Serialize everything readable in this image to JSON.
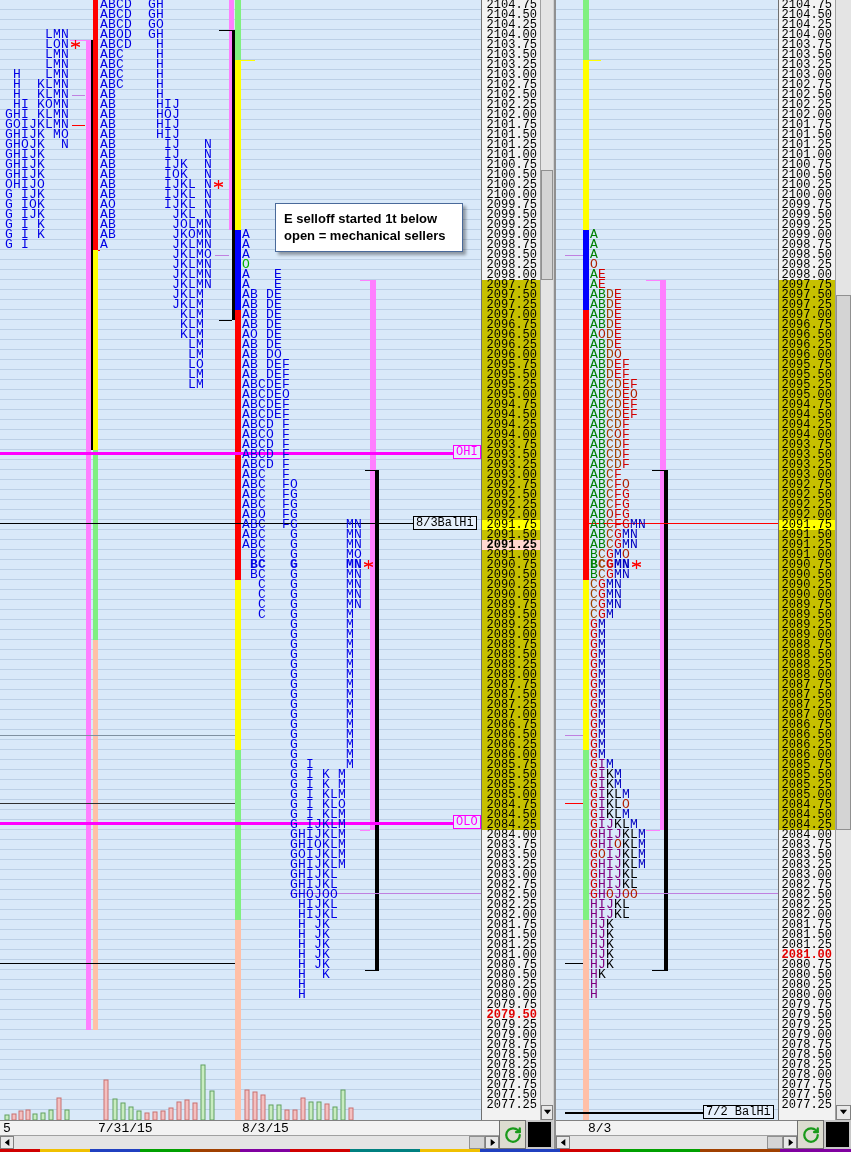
{
  "left_pane": {
    "rows": [
      {
        "price": "2104.75",
        "kind": "plain",
        "p2": "ABCD  GH"
      },
      {
        "price": "2104.50",
        "kind": "plain",
        "p2": "ABCD  GH"
      },
      {
        "price": "2104.25",
        "kind": "plain",
        "p2": "ABCD  GO"
      },
      {
        "price": "2104.00",
        "kind": "plain",
        "p1": "     LMN",
        "p2": "ABOD  GH"
      },
      {
        "price": "2103.75",
        "kind": "plain",
        "p1": "     LON",
        "p1_star": true,
        "p2": "ABCD   H"
      },
      {
        "price": "2103.50",
        "kind": "plain",
        "p1": "     LMN",
        "p2": "ABC    H"
      },
      {
        "price": "2103.25",
        "kind": "plain",
        "p1": "     LMN",
        "p2": "ABC    H"
      },
      {
        "price": "2103.00",
        "kind": "plain",
        "p1": " H   LMN",
        "p2": "ABC    H"
      },
      {
        "price": "2102.75",
        "kind": "plain",
        "p1": " H  KLMN",
        "p2": "ABC    H"
      },
      {
        "price": "2102.50",
        "kind": "plain",
        "p1": " H  KLMN",
        "p2": "AB     H"
      },
      {
        "price": "2102.25",
        "kind": "plain",
        "p1": " HI KOMN",
        "p2": "AB     HIJ"
      },
      {
        "price": "2102.00",
        "kind": "plain",
        "p1": "GHI KLMN",
        "p2": "AB     HOJ"
      },
      {
        "price": "2101.75",
        "kind": "plain",
        "p1": "GOIJKLMN",
        "p2": "AB     HIJ"
      },
      {
        "price": "2101.50",
        "kind": "plain",
        "p1": "GHIJK MO",
        "p2": "AB     HIJ"
      },
      {
        "price": "2101.25",
        "kind": "plain",
        "p1": "GHOJK  N",
        "p2": "AB      IJ   N"
      },
      {
        "price": "2101.00",
        "kind": "plain",
        "p1": "GHIJK",
        "p2": "AB      IJ   N"
      },
      {
        "price": "2100.75",
        "kind": "plain",
        "p1": "GHIJK",
        "p2": "AB      IJK  N"
      },
      {
        "price": "2100.50",
        "kind": "plain",
        "p1": "GHIJK",
        "p2": "AB      IOK  N"
      },
      {
        "price": "2100.25",
        "kind": "plain",
        "p1": "OHIJO",
        "p2": "AB      IJKL N",
        "p2_star": true
      },
      {
        "price": "2100.00",
        "kind": "plain",
        "p1": "G IJK",
        "p2": "AB      IJKL N"
      },
      {
        "price": "2099.75",
        "kind": "plain",
        "p1": "G IOK",
        "p2": "AO      IJKL N"
      },
      {
        "price": "2099.50",
        "kind": "plain",
        "p1": "G IJK",
        "p2": "AB       JKL N"
      },
      {
        "price": "2099.25",
        "kind": "plain",
        "p1": "G I K",
        "p2": "AB       JOLMN"
      },
      {
        "price": "2099.00",
        "kind": "plain",
        "p1": "G I K",
        "p2": "AB       JKOMN",
        "p3": "A"
      },
      {
        "price": "2098.75",
        "kind": "plain",
        "p1": "G I",
        "p2": "A        JKLMN",
        "p3": "A"
      },
      {
        "price": "2098.50",
        "kind": "plain",
        "p2": "         JKLMO",
        "p3": "A"
      },
      {
        "price": "2098.25",
        "kind": "plain",
        "p2": "         JKLMN",
        "p3": "O",
        "p3_open": true
      },
      {
        "price": "2098.00",
        "kind": "plain",
        "p2": "         JKLMN",
        "p3": "A   E"
      },
      {
        "price": "2097.75",
        "kind": "value_area",
        "p2": "         JKLMN",
        "p3": "A   E"
      },
      {
        "price": "2097.50",
        "kind": "value_area",
        "p2": "         JKLM",
        "p3": "AB DE"
      },
      {
        "price": "2097.25",
        "kind": "value_area",
        "p2": "         JKLM",
        "p3": "AB DE"
      },
      {
        "price": "2097.00",
        "kind": "value_area",
        "p2": "          KLM",
        "p3": "AB DE"
      },
      {
        "price": "2096.75",
        "kind": "value_area",
        "p2": "          KLM",
        "p3": "AB DE"
      },
      {
        "price": "2096.50",
        "kind": "value_area",
        "p2": "          KLM",
        "p3": "AO DE"
      },
      {
        "price": "2096.25",
        "kind": "value_area",
        "p2": "           LM",
        "p3": "AB DE"
      },
      {
        "price": "2096.00",
        "kind": "value_area",
        "p2": "           LM",
        "p3": "AB DO"
      },
      {
        "price": "2095.75",
        "kind": "value_area",
        "p2": "           LO",
        "p3": "AB DEF"
      },
      {
        "price": "2095.50",
        "kind": "value_area",
        "p2": "           LM",
        "p3": "AB DEF"
      },
      {
        "price": "2095.25",
        "kind": "value_area",
        "p2": "           LM",
        "p3": "ABCDEF"
      },
      {
        "price": "2095.00",
        "kind": "value_area",
        "p3": "ABCDEO"
      },
      {
        "price": "2094.75",
        "kind": "value_area",
        "p3": "ABCDEF"
      },
      {
        "price": "2094.50",
        "kind": "value_area",
        "p3": "ABCDEF"
      },
      {
        "price": "2094.25",
        "kind": "value_area",
        "p3": "ABCD F"
      },
      {
        "price": "2094.00",
        "kind": "value_area",
        "p3": "ABCO F"
      },
      {
        "price": "2093.75",
        "kind": "value_area",
        "p3": "ABCD F"
      },
      {
        "price": "2093.50",
        "kind": "value_area",
        "p3": "ABCD F"
      },
      {
        "price": "2093.25",
        "kind": "value_area",
        "p3": "ABCD F"
      },
      {
        "price": "2093.00",
        "kind": "value_area",
        "p3": "ABC  F"
      },
      {
        "price": "2092.75",
        "kind": "value_area",
        "p3": "ABC  FO"
      },
      {
        "price": "2092.50",
        "kind": "value_area",
        "p3": "ABC  FG"
      },
      {
        "price": "2092.25",
        "kind": "value_area",
        "p3": "ABC  FG"
      },
      {
        "price": "2092.00",
        "kind": "value_area",
        "p3": "ABO  FG"
      },
      {
        "price": "2091.75",
        "kind": "current",
        "p3": "ABC  FG      MN"
      },
      {
        "price": "2091.50",
        "kind": "value_area",
        "p3": "ABC   G      MN"
      },
      {
        "price": "2091.25",
        "kind": "poc",
        "p3": "ABC   G      MN"
      },
      {
        "price": "2091.00",
        "kind": "value_area",
        "p3": " BC   G      MO"
      },
      {
        "price": "2090.75",
        "kind": "value_area",
        "p3": " BC   G      MN",
        "p3_star": true,
        "bold": true
      },
      {
        "price": "2090.50",
        "kind": "value_area",
        "p3": " BC   G      MN"
      },
      {
        "price": "2090.25",
        "kind": "value_area",
        "p3": "  C   G      MN"
      },
      {
        "price": "2090.00",
        "kind": "value_area",
        "p3": "  C   G      MN"
      },
      {
        "price": "2089.75",
        "kind": "value_area",
        "p3": "  C   G      MN"
      },
      {
        "price": "2089.50",
        "kind": "value_area",
        "p3": "  C   G      M"
      },
      {
        "price": "2089.25",
        "kind": "value_area",
        "p3": "      G      M"
      },
      {
        "price": "2089.00",
        "kind": "value_area",
        "p3": "      G      M"
      },
      {
        "price": "2088.75",
        "kind": "value_area",
        "p3": "      G      M"
      },
      {
        "price": "2088.50",
        "kind": "value_area",
        "p3": "      G      M"
      },
      {
        "price": "2088.25",
        "kind": "value_area",
        "p3": "      G      M"
      },
      {
        "price": "2088.00",
        "kind": "value_area",
        "p3": "      G      M"
      },
      {
        "price": "2087.75",
        "kind": "value_area",
        "p3": "      G      M"
      },
      {
        "price": "2087.50",
        "kind": "value_area",
        "p3": "      G      M"
      },
      {
        "price": "2087.25",
        "kind": "value_area",
        "p3": "      G      M"
      },
      {
        "price": "2087.00",
        "kind": "value_area",
        "p3": "      G      M"
      },
      {
        "price": "2086.75",
        "kind": "value_area",
        "p3": "      G      M"
      },
      {
        "price": "2086.50",
        "kind": "value_area",
        "p3": "      G      M"
      },
      {
        "price": "2086.25",
        "kind": "value_area",
        "p3": "      G      M"
      },
      {
        "price": "2086.00",
        "kind": "value_area",
        "p3": "      G      M"
      },
      {
        "price": "2085.75",
        "kind": "value_area",
        "p3": "      G I    M"
      },
      {
        "price": "2085.50",
        "kind": "value_area",
        "p3": "      G I K M"
      },
      {
        "price": "2085.25",
        "kind": "value_area",
        "p3": "      G I K M"
      },
      {
        "price": "2085.00",
        "kind": "value_area",
        "p3": "      G I KLM"
      },
      {
        "price": "2084.75",
        "kind": "value_area",
        "p3": "      G I KLO"
      },
      {
        "price": "2084.50",
        "kind": "value_area",
        "p3": "      G I KLM"
      },
      {
        "price": "2084.25",
        "kind": "value_area",
        "p3": "      G IJKLM"
      },
      {
        "price": "2084.00",
        "kind": "plain",
        "p3": "      GHIJKLM"
      },
      {
        "price": "2083.75",
        "kind": "plain",
        "p3": "      GHIOKLM"
      },
      {
        "price": "2083.50",
        "kind": "plain",
        "p3": "      GOIJKLM"
      },
      {
        "price": "2083.25",
        "kind": "plain",
        "p3": "      GHIJKLM"
      },
      {
        "price": "2083.00",
        "kind": "plain",
        "p3": "      GHIJKL"
      },
      {
        "price": "2082.75",
        "kind": "plain",
        "p3": "      GHIJKL"
      },
      {
        "price": "2082.50",
        "kind": "plain",
        "p3": "      GHOJOO"
      },
      {
        "price": "2082.25",
        "kind": "plain",
        "p3": "       HIJKL"
      },
      {
        "price": "2082.00",
        "kind": "plain",
        "p3": "       HIJKL"
      },
      {
        "price": "2081.75",
        "kind": "plain",
        "p3": "       H JK"
      },
      {
        "price": "2081.50",
        "kind": "plain",
        "p3": "       H JK"
      },
      {
        "price": "2081.25",
        "kind": "plain",
        "p3": "       H JK"
      },
      {
        "price": "2081.00",
        "kind": "plain",
        "p3": "       H JK"
      },
      {
        "price": "2080.75",
        "kind": "plain",
        "p3": "       H JK"
      },
      {
        "price": "2080.50",
        "kind": "plain",
        "p3": "       H  K"
      },
      {
        "price": "2080.25",
        "kind": "plain",
        "p3": "       H"
      },
      {
        "price": "2080.00",
        "kind": "plain",
        "p3": "       H"
      },
      {
        "price": "2079.75",
        "kind": "plain"
      },
      {
        "price": "2079.50",
        "kind": "low"
      },
      {
        "price": "2079.25",
        "kind": "plain"
      },
      {
        "price": "2079.00",
        "kind": "plain"
      },
      {
        "price": "2078.75",
        "kind": "plain"
      },
      {
        "price": "2078.50",
        "kind": "plain"
      },
      {
        "price": "2078.25",
        "kind": "plain"
      },
      {
        "price": "2078.00",
        "kind": "plain"
      },
      {
        "price": "2077.75",
        "kind": "plain"
      },
      {
        "price": "2077.50",
        "kind": "plain"
      },
      {
        "price": "2077.25",
        "kind": "plain"
      }
    ],
    "level_labels": [
      "OHI",
      "OLO"
    ],
    "balance_label": "8/3BalHi",
    "note": "E selloff started 1t below open = mechanical sellers",
    "dates": [
      "5",
      "7/31/15",
      "8/3/15"
    ]
  },
  "right_pane": {
    "rows": [
      {
        "price": "2104.75",
        "kind": "plain"
      },
      {
        "price": "2104.50",
        "kind": "plain"
      },
      {
        "price": "2104.25",
        "kind": "plain"
      },
      {
        "price": "2104.00",
        "kind": "plain"
      },
      {
        "price": "2103.75",
        "kind": "plain"
      },
      {
        "price": "2103.50",
        "kind": "plain"
      },
      {
        "price": "2103.25",
        "kind": "plain"
      },
      {
        "price": "2103.00",
        "kind": "plain"
      },
      {
        "price": "2102.75",
        "kind": "plain"
      },
      {
        "price": "2102.50",
        "kind": "plain"
      },
      {
        "price": "2102.25",
        "kind": "plain"
      },
      {
        "price": "2102.00",
        "kind": "plain"
      },
      {
        "price": "2101.75",
        "kind": "plain"
      },
      {
        "price": "2101.50",
        "kind": "plain"
      },
      {
        "price": "2101.25",
        "kind": "plain"
      },
      {
        "price": "2101.00",
        "kind": "plain"
      },
      {
        "price": "2100.75",
        "kind": "plain"
      },
      {
        "price": "2100.50",
        "kind": "plain"
      },
      {
        "price": "2100.25",
        "kind": "plain"
      },
      {
        "price": "2100.00",
        "kind": "plain"
      },
      {
        "price": "2099.75",
        "kind": "plain"
      },
      {
        "price": "2099.50",
        "kind": "plain"
      },
      {
        "price": "2099.25",
        "kind": "plain"
      },
      {
        "price": "2099.00",
        "kind": "plain",
        "tpo": "A"
      },
      {
        "price": "2098.75",
        "kind": "plain",
        "tpo": "A"
      },
      {
        "price": "2098.50",
        "kind": "plain",
        "tpo": "A"
      },
      {
        "price": "2098.25",
        "kind": "plain",
        "tpo": "O"
      },
      {
        "price": "2098.00",
        "kind": "plain",
        "tpo": "AE"
      },
      {
        "price": "2097.75",
        "kind": "value_area",
        "tpo": "AE"
      },
      {
        "price": "2097.50",
        "kind": "value_area",
        "tpo": "ABDE"
      },
      {
        "price": "2097.25",
        "kind": "value_area",
        "tpo": "ABDE"
      },
      {
        "price": "2097.00",
        "kind": "value_area",
        "tpo": "ABDE"
      },
      {
        "price": "2096.75",
        "kind": "value_area",
        "tpo": "ABDE"
      },
      {
        "price": "2096.50",
        "kind": "value_area",
        "tpo": "AODE"
      },
      {
        "price": "2096.25",
        "kind": "value_area",
        "tpo": "ABDE"
      },
      {
        "price": "2096.00",
        "kind": "value_area",
        "tpo": "ABDO"
      },
      {
        "price": "2095.75",
        "kind": "value_area",
        "tpo": "ABDEF"
      },
      {
        "price": "2095.50",
        "kind": "value_area",
        "tpo": "ABDEF"
      },
      {
        "price": "2095.25",
        "kind": "value_area",
        "tpo": "ABCDEF"
      },
      {
        "price": "2095.00",
        "kind": "value_area",
        "tpo": "ABCDEO"
      },
      {
        "price": "2094.75",
        "kind": "value_area",
        "tpo": "ABCDEF"
      },
      {
        "price": "2094.50",
        "kind": "value_area",
        "tpo": "ABCDEF"
      },
      {
        "price": "2094.25",
        "kind": "value_area",
        "tpo": "ABCDF"
      },
      {
        "price": "2094.00",
        "kind": "value_area",
        "tpo": "ABCOF"
      },
      {
        "price": "2093.75",
        "kind": "value_area",
        "tpo": "ABCDF"
      },
      {
        "price": "2093.50",
        "kind": "value_area",
        "tpo": "ABCDF"
      },
      {
        "price": "2093.25",
        "kind": "value_area",
        "tpo": "ABCDF"
      },
      {
        "price": "2093.00",
        "kind": "value_area",
        "tpo": "ABCF"
      },
      {
        "price": "2092.75",
        "kind": "value_area",
        "tpo": "ABCFO"
      },
      {
        "price": "2092.50",
        "kind": "value_area",
        "tpo": "ABCFG"
      },
      {
        "price": "2092.25",
        "kind": "value_area",
        "tpo": "ABCFG"
      },
      {
        "price": "2092.00",
        "kind": "value_area",
        "tpo": "ABOFG"
      },
      {
        "price": "2091.75",
        "kind": "current",
        "tpo": "ABCFGMN"
      },
      {
        "price": "2091.50",
        "kind": "value_area",
        "tpo": "ABCGMN"
      },
      {
        "price": "2091.25",
        "kind": "value_area",
        "tpo": "ABCGMN"
      },
      {
        "price": "2091.00",
        "kind": "value_area",
        "tpo": "BCGMO"
      },
      {
        "price": "2090.75",
        "kind": "value_area",
        "tpo": "BCGMN",
        "star": true,
        "bold": true
      },
      {
        "price": "2090.50",
        "kind": "value_area",
        "tpo": "BCGMN"
      },
      {
        "price": "2090.25",
        "kind": "value_area",
        "tpo": "CGMN"
      },
      {
        "price": "2090.00",
        "kind": "value_area",
        "tpo": "CGMN"
      },
      {
        "price": "2089.75",
        "kind": "value_area",
        "tpo": "CGMN"
      },
      {
        "price": "2089.50",
        "kind": "value_area",
        "tpo": "CGM"
      },
      {
        "price": "2089.25",
        "kind": "value_area",
        "tpo": "GM"
      },
      {
        "price": "2089.00",
        "kind": "value_area",
        "tpo": "GM"
      },
      {
        "price": "2088.75",
        "kind": "value_area",
        "tpo": "GM"
      },
      {
        "price": "2088.50",
        "kind": "value_area",
        "tpo": "GM"
      },
      {
        "price": "2088.25",
        "kind": "value_area",
        "tpo": "GM"
      },
      {
        "price": "2088.00",
        "kind": "value_area",
        "tpo": "GM"
      },
      {
        "price": "2087.75",
        "kind": "value_area",
        "tpo": "GM"
      },
      {
        "price": "2087.50",
        "kind": "value_area",
        "tpo": "GM"
      },
      {
        "price": "2087.25",
        "kind": "value_area",
        "tpo": "GM"
      },
      {
        "price": "2087.00",
        "kind": "value_area",
        "tpo": "GM"
      },
      {
        "price": "2086.75",
        "kind": "value_area",
        "tpo": "GM"
      },
      {
        "price": "2086.50",
        "kind": "value_area",
        "tpo": "GM"
      },
      {
        "price": "2086.25",
        "kind": "value_area",
        "tpo": "GM"
      },
      {
        "price": "2086.00",
        "kind": "value_area",
        "tpo": "GM"
      },
      {
        "price": "2085.75",
        "kind": "value_area",
        "tpo": "GIM"
      },
      {
        "price": "2085.50",
        "kind": "value_area",
        "tpo": "GIKM"
      },
      {
        "price": "2085.25",
        "kind": "value_area",
        "tpo": "GIKM"
      },
      {
        "price": "2085.00",
        "kind": "value_area",
        "tpo": "GIKLM"
      },
      {
        "price": "2084.75",
        "kind": "value_area",
        "tpo": "GIKLO"
      },
      {
        "price": "2084.50",
        "kind": "value_area",
        "tpo": "GIKLM"
      },
      {
        "price": "2084.25",
        "kind": "value_area",
        "tpo": "GIJKLM"
      },
      {
        "price": "2084.00",
        "kind": "plain",
        "tpo": "GHIJKLM"
      },
      {
        "price": "2083.75",
        "kind": "plain",
        "tpo": "GHIOKLM"
      },
      {
        "price": "2083.50",
        "kind": "plain",
        "tpo": "GOIJKLM"
      },
      {
        "price": "2083.25",
        "kind": "plain",
        "tpo": "GHIJKLM"
      },
      {
        "price": "2083.00",
        "kind": "plain",
        "tpo": "GHIJKL"
      },
      {
        "price": "2082.75",
        "kind": "plain",
        "tpo": "GHIJKL"
      },
      {
        "price": "2082.50",
        "kind": "plain",
        "tpo": "GHOJOO"
      },
      {
        "price": "2082.25",
        "kind": "plain",
        "tpo": "HIJKL"
      },
      {
        "price": "2082.00",
        "kind": "plain",
        "tpo": "HIJKL"
      },
      {
        "price": "2081.75",
        "kind": "plain",
        "tpo": "HJK"
      },
      {
        "price": "2081.50",
        "kind": "plain",
        "tpo": "HJK"
      },
      {
        "price": "2081.25",
        "kind": "plain",
        "tpo": "HJK"
      },
      {
        "price": "2081.00",
        "kind": "low",
        "tpo": "HJK"
      },
      {
        "price": "2080.75",
        "kind": "plain",
        "tpo": "HJK"
      },
      {
        "price": "2080.50",
        "kind": "plain",
        "tpo": "HK"
      },
      {
        "price": "2080.25",
        "kind": "plain",
        "tpo": "H"
      },
      {
        "price": "2080.00",
        "kind": "plain",
        "tpo": "H"
      },
      {
        "price": "2079.75",
        "kind": "plain"
      },
      {
        "price": "2079.50",
        "kind": "plain"
      },
      {
        "price": "2079.25",
        "kind": "plain"
      },
      {
        "price": "2079.00",
        "kind": "plain"
      },
      {
        "price": "2078.75",
        "kind": "plain"
      },
      {
        "price": "2078.50",
        "kind": "plain"
      },
      {
        "price": "2078.25",
        "kind": "plain"
      },
      {
        "price": "2078.00",
        "kind": "plain"
      },
      {
        "price": "2077.75",
        "kind": "plain"
      },
      {
        "price": "2077.50",
        "kind": "plain"
      },
      {
        "price": "2077.25",
        "kind": "plain"
      }
    ],
    "balance_label": "7/2 BalHi",
    "dates": [
      "8/3"
    ]
  }
}
